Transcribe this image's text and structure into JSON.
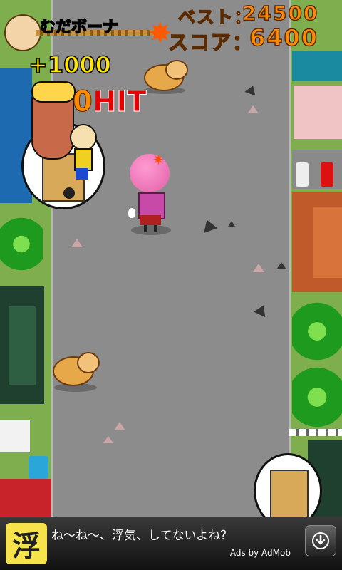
{
  "hud": {
    "best_label": "ベスト：",
    "best_value": "24500",
    "score_label": "スコア：",
    "score_value": "6400",
    "bonus_label": "むだボーナ",
    "bonus_points": "+1000",
    "hit_prefix": "0",
    "hit_label": "HIT"
  },
  "ad": {
    "icon_char": "浮",
    "text": "ね～ね～、浮気、してないよね？",
    "by": "Ads by AdMob"
  },
  "colors": {
    "road": "#8c8c8c",
    "score": "#ff8a00",
    "hit": "#e60000"
  }
}
